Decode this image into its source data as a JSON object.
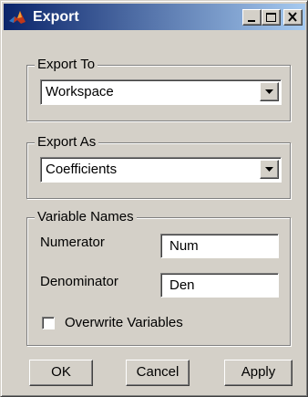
{
  "window": {
    "title": "Export"
  },
  "export_to": {
    "legend": "Export To",
    "selected": "Workspace"
  },
  "export_as": {
    "legend": "Export As",
    "selected": "Coefficients"
  },
  "variable_names": {
    "legend": "Variable Names",
    "numerator_label": "Numerator",
    "numerator_value": "Num",
    "denominator_label": "Denominator",
    "denominator_value": "Den",
    "overwrite_label": "Overwrite Variables",
    "overwrite_checked": false
  },
  "buttons": {
    "ok": "OK",
    "cancel": "Cancel",
    "apply": "Apply"
  },
  "icons": {
    "app": "matlab-icon",
    "minimize": "minimize-icon",
    "maximize": "maximize-icon",
    "close": "close-icon",
    "dropdown": "dropdown-arrow-icon"
  },
  "colors": {
    "face": "#d4d0c8",
    "titlebar_start": "#0a246a",
    "titlebar_end": "#a6caf0"
  }
}
